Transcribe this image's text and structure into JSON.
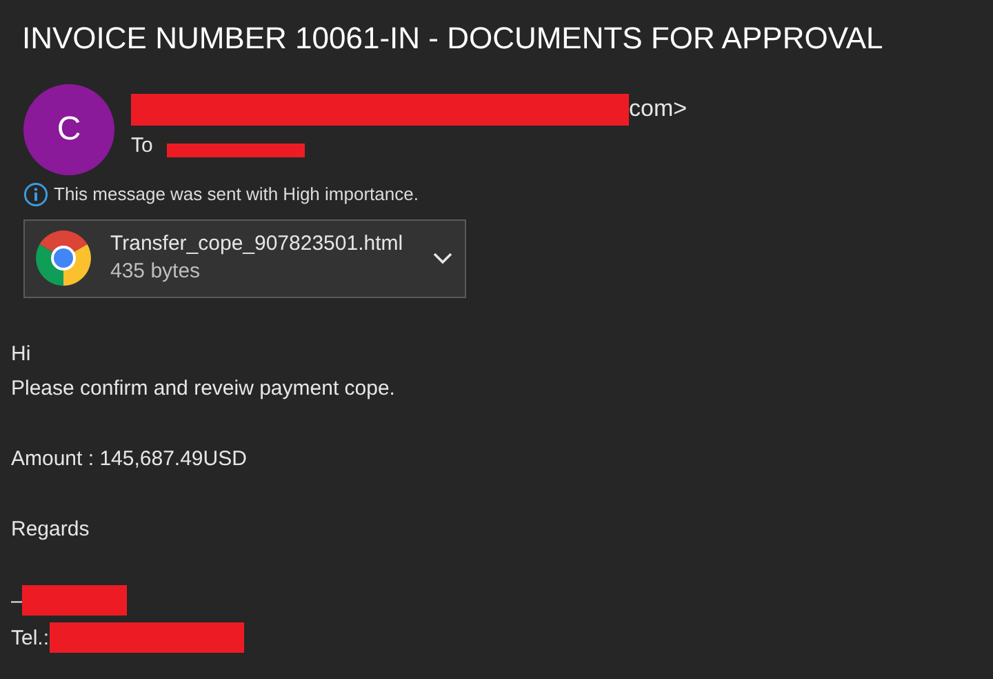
{
  "subject": "INVOICE NUMBER 10061-IN - DOCUMENTS FOR APPROVAL",
  "sender": {
    "initial": "C",
    "address_end": "com>"
  },
  "recipient": {
    "label": "To"
  },
  "importance_note": "This message was sent with High importance.",
  "attachment": {
    "filename": "Transfer_cope_907823501.html",
    "size": "435 bytes"
  },
  "body": [
    {
      "kind": "text",
      "lines": [
        "Hi",
        "Please confirm and reveiw payment cope."
      ]
    },
    {
      "kind": "text",
      "lines": [
        "Amount : 145,687.49USD"
      ]
    },
    {
      "kind": "text",
      "lines": [
        "Regards"
      ]
    },
    {
      "kind": "signature",
      "lines": [
        "–",
        "Tel.:"
      ]
    }
  ]
}
